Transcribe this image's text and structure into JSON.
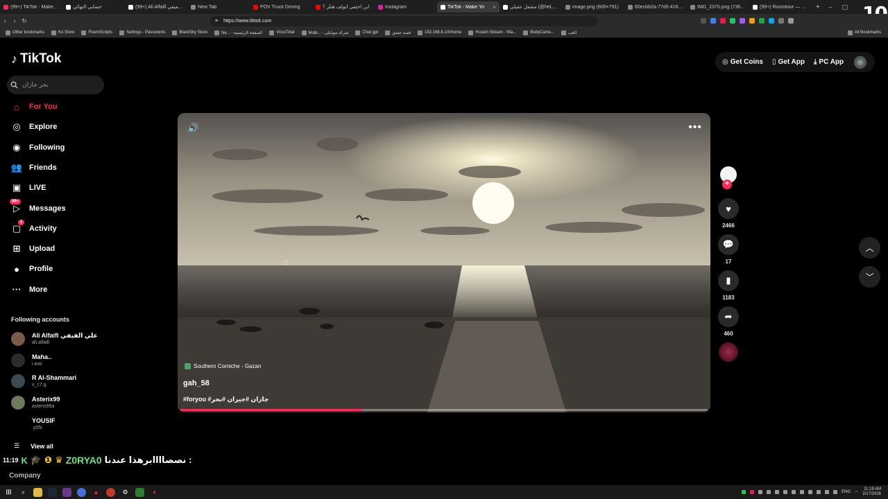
{
  "browser": {
    "tabs": [
      {
        "title": "(99+) TikTok - Make Your",
        "fav": "#fe2c55"
      },
      {
        "title": "حسابي النهائي",
        "fav": "#ffffff"
      },
      {
        "title": "(99+) Ali Alfaifi علي الفيفي",
        "fav": "#ffffff"
      },
      {
        "title": "New Tab",
        "fav": "#888888"
      },
      {
        "title": "POV Truck Driving",
        "fav": "#ff0000"
      },
      {
        "title": "ابن احتفى اتولف هتلر ؟",
        "fav": "#ff0000"
      },
      {
        "title": "Instagram",
        "fav": "#d6249f"
      },
      {
        "title": "TikTok - Make Yo",
        "fav": "#ffffff",
        "active": true
      },
      {
        "title": "مشعل عقيلي (@heL97)",
        "fav": "#ffffff"
      },
      {
        "title": "image.png (600×791)",
        "fav": "#888888"
      },
      {
        "title": "60ecbb2a-77d0-416d-8",
        "fav": "#888888"
      },
      {
        "title": "IMG_2370.png (736×47",
        "fav": "#888888"
      },
      {
        "title": "(99+) Roomtour — 東京",
        "fav": "#ffffff"
      }
    ],
    "tab_close": "×",
    "new_tab": "+",
    "url": "https://www.tiktok.com",
    "top_right_badge": "10",
    "bookmarks": [
      "Other bookmarks",
      "Ko Store",
      "FivemScripts",
      "Settings - Passwords",
      "BlackSky Store",
      "Ne... - الصفحة الرئيسية",
      "VirusTotal",
      "Mobi... - شركة موبايلي",
      "Chat gpt",
      "قصة عشق",
      "192.168.8.1/#/home",
      "Husein Stream - Wa...",
      "BodyCame...",
      "العب"
    ],
    "all_bookmarks": "All Bookmarks"
  },
  "header": {
    "logo": "TikTok",
    "search_placeholder": "بحر جازان",
    "get_coins": "Get Coins",
    "get_app": "Get App",
    "pc_app": "PC App"
  },
  "nav": [
    {
      "label": "For You",
      "icon": "home-icon",
      "glyph": "⌂",
      "active": true
    },
    {
      "label": "Explore",
      "icon": "compass-icon",
      "glyph": "◎"
    },
    {
      "label": "Following",
      "icon": "following-avatar-icon",
      "glyph": "◉"
    },
    {
      "label": "Friends",
      "icon": "friends-icon",
      "glyph": "👥"
    },
    {
      "label": "LIVE",
      "icon": "live-icon",
      "glyph": "▣"
    },
    {
      "label": "Messages",
      "icon": "messages-icon",
      "glyph": "▷",
      "badge": "99+"
    },
    {
      "label": "Activity",
      "icon": "activity-icon",
      "glyph": "▢",
      "badge": "3"
    },
    {
      "label": "Upload",
      "icon": "upload-icon",
      "glyph": "⊞"
    },
    {
      "label": "Profile",
      "icon": "profile-avatar-icon",
      "glyph": "●"
    },
    {
      "label": "More",
      "icon": "more-icon",
      "glyph": "···"
    }
  ],
  "following": {
    "header": "Following accounts",
    "accounts": [
      {
        "name": "Ali Alfaifi علي الفيفي",
        "user": "ali.alfaifi",
        "color": "#7a5a4a"
      },
      {
        "name": "Maha..",
        "user": "i.exti",
        "color": "#2b2b2b"
      },
      {
        "name": "R Al-Shammari",
        "user": "v_c7.g",
        "color": "#3c4a4f"
      },
      {
        "name": "Asterix99",
        "user": "asterix99a",
        "color": "#6d7a5c"
      },
      {
        "name": "YOUSIF",
        "user": ".y05i",
        "color": "#000000"
      }
    ],
    "view_all": "View all"
  },
  "overlay": {
    "time": "11:19",
    "username": "Z0RYA0",
    "message": "نصصاااابرهذا عندنا :"
  },
  "company": "Company",
  "video": {
    "location": "Southern Corniche - Gazan",
    "username": "gah_58",
    "tags": "#foryou #جازان #جيزان #بحر",
    "progress": 0.345
  },
  "actions": {
    "likes": "2466",
    "comments": "17",
    "saves": "1183",
    "shares": "460"
  },
  "taskbar": {
    "time": "11:19 AM",
    "date": "2/17/2026",
    "lang": "ENG"
  }
}
